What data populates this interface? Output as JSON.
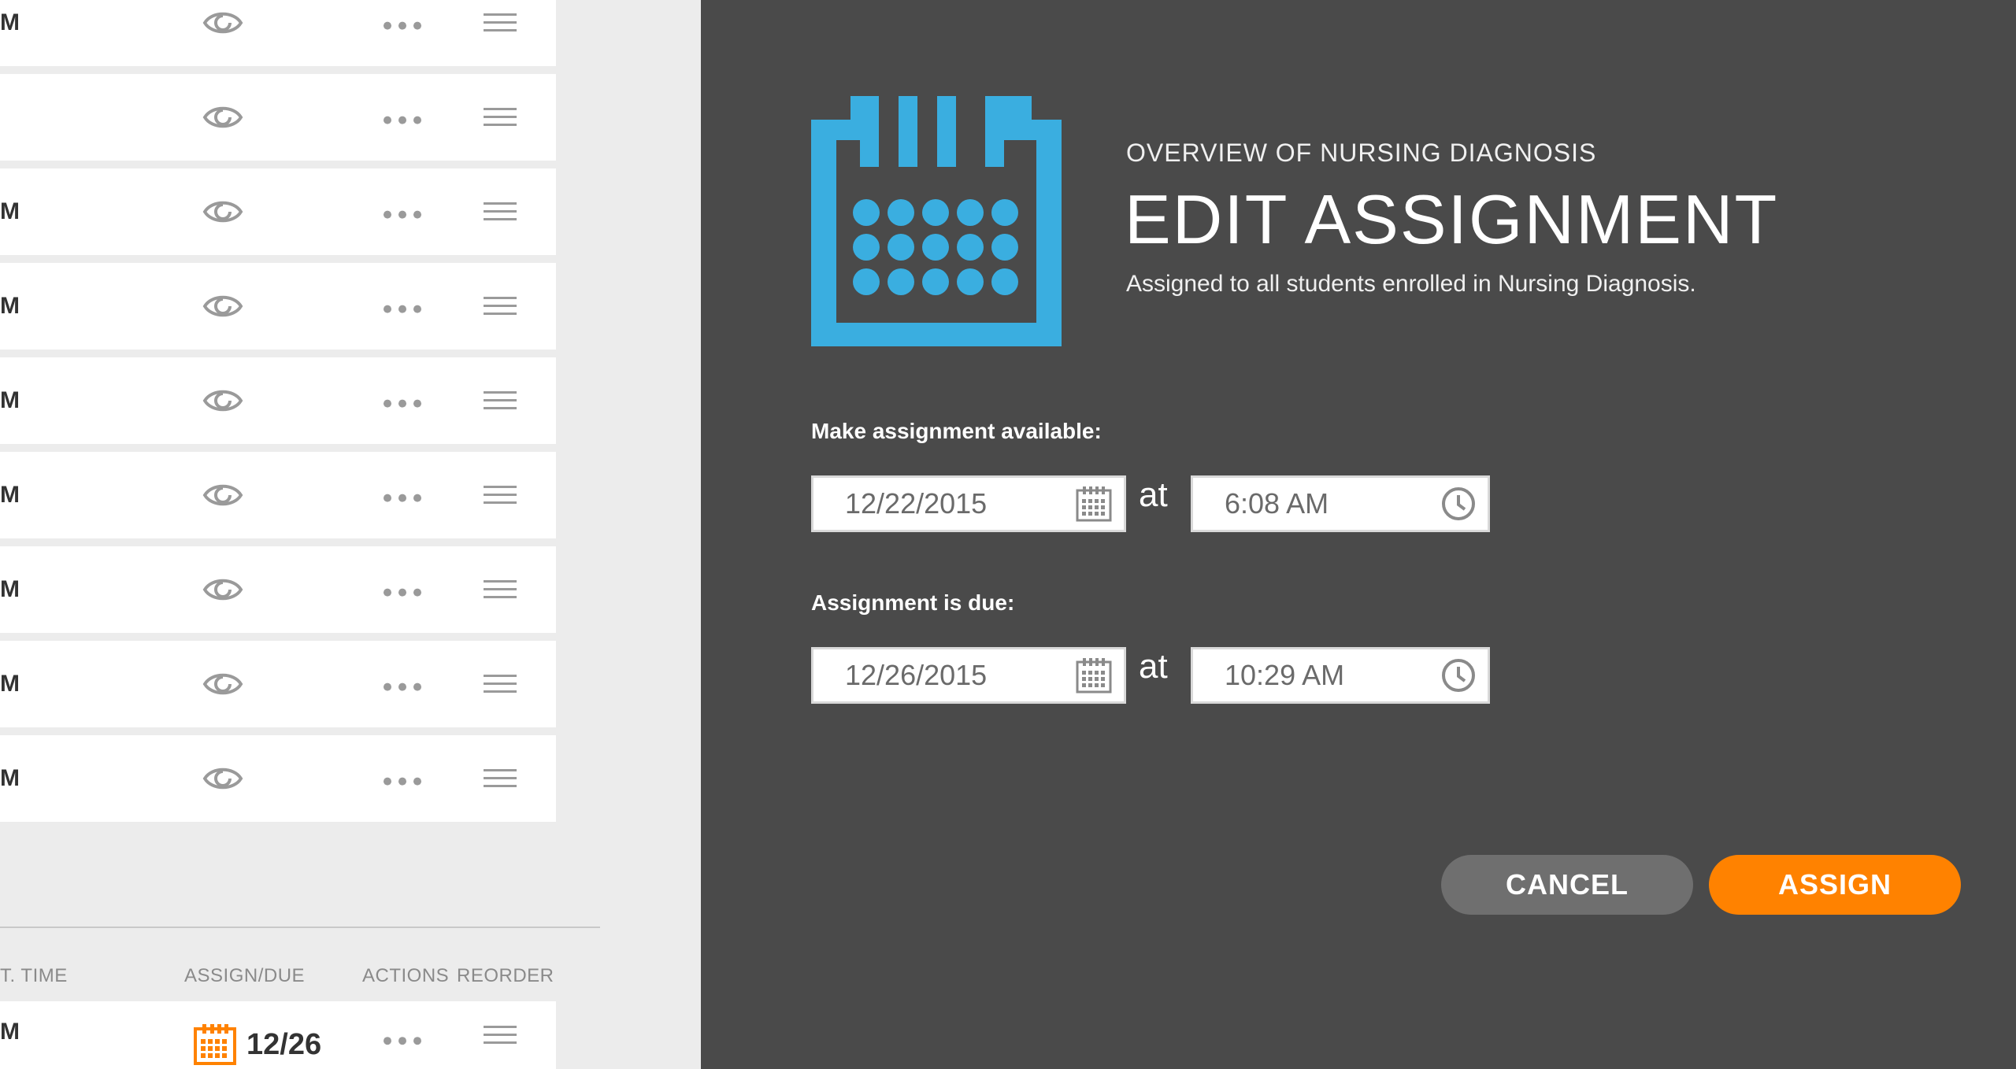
{
  "list": {
    "rows": [
      {
        "label": "M"
      },
      {
        "label": ""
      },
      {
        "label": "M"
      },
      {
        "label": "M"
      },
      {
        "label": "M"
      },
      {
        "label": "M"
      },
      {
        "label": "M"
      },
      {
        "label": "M"
      },
      {
        "label": "M"
      }
    ],
    "headers": {
      "time": "T. TIME",
      "assign_due": "ASSIGN/DUE",
      "actions": "ACTIONS",
      "reorder": "REORDER"
    },
    "bottom_row": {
      "label": "M",
      "due": "12/26"
    }
  },
  "modal": {
    "subtitle": "OVERVIEW OF NURSING DIAGNOSIS",
    "title": "EDIT ASSIGNMENT",
    "description": "Assigned to all students enrolled in Nursing Diagnosis.",
    "available": {
      "label": "Make assignment available:",
      "date": "12/22/2015",
      "at": "at",
      "time": "6:08 AM"
    },
    "due": {
      "label": "Assignment is due:",
      "date": "12/26/2015",
      "at": "at",
      "time": "10:29 AM"
    },
    "cancel_label": "CANCEL",
    "assign_label": "ASSIGN"
  },
  "colors": {
    "accent_blue": "#3aaee0",
    "accent_orange": "#ff8200",
    "modal_bg": "#4a4a4a"
  },
  "icons": {
    "eye": "eye-icon",
    "more": "more-dots-icon",
    "reorder": "reorder-icon",
    "calendar": "calendar-icon",
    "clock": "clock-icon"
  }
}
